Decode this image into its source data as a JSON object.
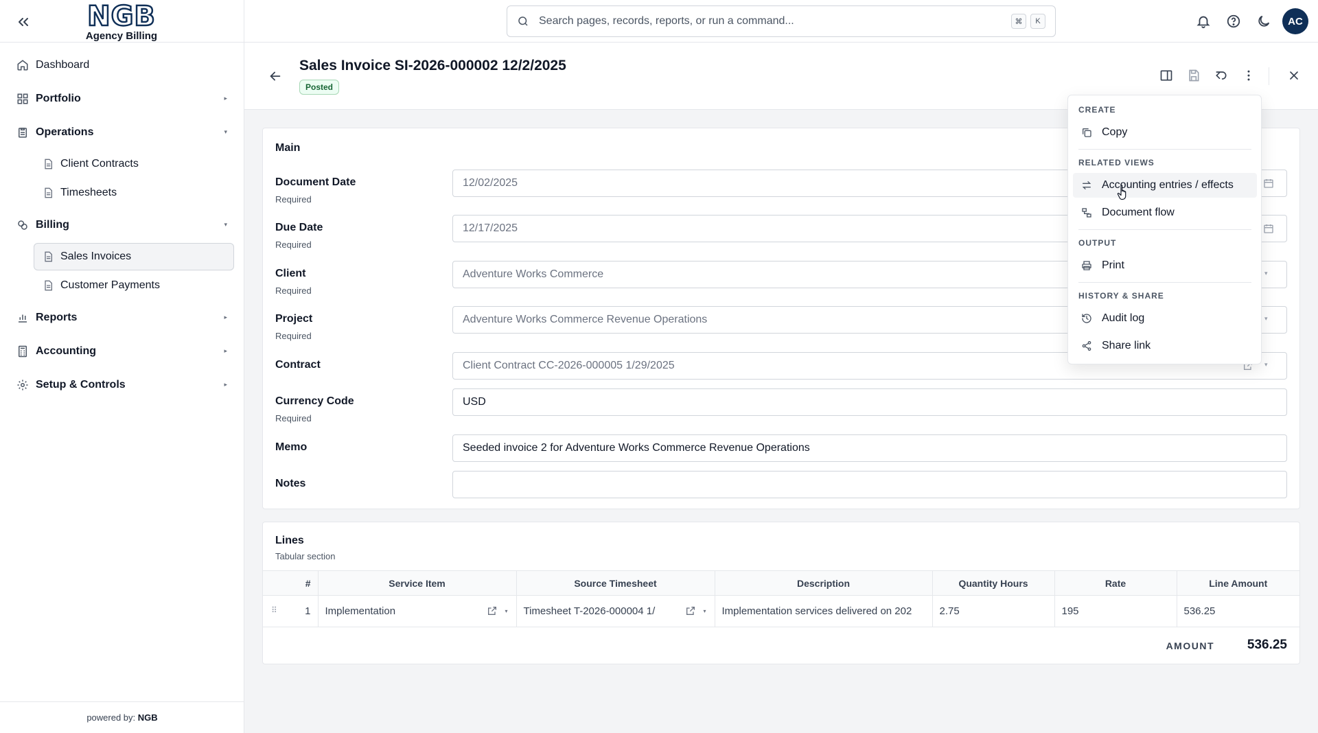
{
  "app": {
    "logo_text": "NGB",
    "subtitle": "Agency Billing",
    "powered_by_prefix": "powered by:",
    "powered_by_brand": "NGB"
  },
  "sidebar": {
    "items": [
      {
        "label": "Dashboard",
        "icon": "home-icon"
      },
      {
        "label": "Portfolio",
        "icon": "grid-icon"
      },
      {
        "label": "Operations",
        "icon": "clipboard-icon"
      },
      {
        "label": "Client Contracts",
        "icon": "document-icon"
      },
      {
        "label": "Timesheets",
        "icon": "document-icon"
      },
      {
        "label": "Billing",
        "icon": "coins-icon"
      },
      {
        "label": "Sales Invoices",
        "icon": "document-icon",
        "active": true
      },
      {
        "label": "Customer Payments",
        "icon": "document-icon"
      },
      {
        "label": "Reports",
        "icon": "bar-chart-icon"
      },
      {
        "label": "Accounting",
        "icon": "calculator-icon"
      },
      {
        "label": "Setup & Controls",
        "icon": "gear-icon"
      }
    ]
  },
  "topbar": {
    "search_placeholder": "Search pages, records, reports, or run a command...",
    "shortcut_key1": "⌘",
    "shortcut_key2": "K",
    "avatar_initials": "AC"
  },
  "document": {
    "title": "Sales Invoice SI-2026-000002 12/2/2025",
    "status": "Posted",
    "status_color": "#166534"
  },
  "main_section": {
    "title": "Main",
    "required_text": "Required",
    "fields": {
      "document_date": {
        "label": "Document Date",
        "value": "12/02/2025"
      },
      "due_date": {
        "label": "Due Date",
        "value": "12/17/2025"
      },
      "client": {
        "label": "Client",
        "value": "Adventure Works Commerce"
      },
      "project": {
        "label": "Project",
        "value": "Adventure Works Commerce Revenue Operations"
      },
      "contract": {
        "label": "Contract",
        "value": "Client Contract CC-2026-000005 1/29/2025"
      },
      "currency_code": {
        "label": "Currency Code",
        "value": "USD"
      },
      "memo": {
        "label": "Memo",
        "value": "Seeded invoice 2 for Adventure Works Commerce Revenue Operations"
      },
      "notes": {
        "label": "Notes",
        "value": ""
      }
    }
  },
  "lines_section": {
    "title": "Lines",
    "subtitle": "Tabular section",
    "columns": [
      "#",
      "Service Item",
      "Source Timesheet",
      "Description",
      "Quantity Hours",
      "Rate",
      "Line Amount"
    ],
    "rows": [
      {
        "num": "1",
        "service_item": "Implementation",
        "source_timesheet": "Timesheet T-2026-000004 1/",
        "description": "Implementation services delivered on 202",
        "quantity_hours": "2.75",
        "rate": "195",
        "line_amount": "536.25"
      }
    ],
    "amount_label": "AMOUNT",
    "amount_value": "536.25"
  },
  "menu": {
    "sections": {
      "create": "CREATE",
      "related_views": "RELATED VIEWS",
      "output": "OUTPUT",
      "history_share": "HISTORY & SHARE"
    },
    "items": {
      "copy": "Copy",
      "accounting_entries": "Accounting entries / effects",
      "document_flow": "Document flow",
      "print": "Print",
      "audit_log": "Audit log",
      "share_link": "Share link"
    }
  }
}
